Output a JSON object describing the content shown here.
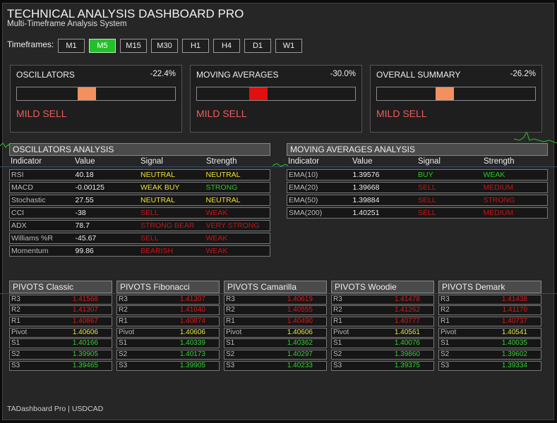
{
  "header": {
    "title": "TECHNICAL ANALYSIS DASHBOARD PRO",
    "subtitle": "Multi-Timeframe Analysis System"
  },
  "timeframes": {
    "label": "Timeframes:",
    "items": [
      "M1",
      "M5",
      "M15",
      "M30",
      "H1",
      "H4",
      "D1",
      "W1"
    ],
    "active": "M5"
  },
  "summary_cards": [
    {
      "title": "OSCILLATORS",
      "percent": "-22.4%",
      "signal": "MILD SELL",
      "gauge_level": 0.44,
      "thumb_color": "#f39060"
    },
    {
      "title": "MOVING AVERAGES",
      "percent": "-30.0%",
      "signal": "MILD SELL",
      "gauge_level": 0.39,
      "thumb_color": "#e01010"
    },
    {
      "title": "OVERALL SUMMARY",
      "percent": "-26.2%",
      "signal": "MILD SELL",
      "gauge_level": 0.43,
      "thumb_color": "#f39060"
    }
  ],
  "oscillators_analysis": {
    "title": "OSCILLATORS ANALYSIS",
    "columns": [
      "Indicator",
      "Value",
      "Signal",
      "Strength"
    ],
    "rows": [
      {
        "indicator": "RSI",
        "value": "40.18",
        "signal": "NEUTRAL",
        "signal_color": "yellow",
        "strength": "NEUTRAL",
        "strength_color": "yellow"
      },
      {
        "indicator": "MACD",
        "value": "-0.00125",
        "signal": "WEAK BUY",
        "signal_color": "yellow",
        "strength": "STRONG",
        "strength_color": "green"
      },
      {
        "indicator": "Stochastic",
        "value": "27.55",
        "signal": "NEUTRAL",
        "signal_color": "yellow",
        "strength": "NEUTRAL",
        "strength_color": "yellow"
      },
      {
        "indicator": "CCI",
        "value": "-38",
        "signal": "SELL",
        "signal_color": "red",
        "strength": "WEAK",
        "strength_color": "red"
      },
      {
        "indicator": "ADX",
        "value": "78.7",
        "signal": "STRONG BEAR",
        "signal_color": "red",
        "strength": "VERY STRONG",
        "strength_color": "red"
      },
      {
        "indicator": "Williams %R",
        "value": "-45.67",
        "signal": "SELL",
        "signal_color": "red",
        "strength": "WEAK",
        "strength_color": "red"
      },
      {
        "indicator": "Momentum",
        "value": "99.86",
        "signal": "BEARISH",
        "signal_color": "red",
        "strength": "WEAK",
        "strength_color": "red"
      }
    ]
  },
  "moving_averages_analysis": {
    "title": "MOVING AVERAGES ANALYSIS",
    "columns": [
      "Indicator",
      "Value",
      "Signal",
      "Strength"
    ],
    "rows": [
      {
        "indicator": "EMA(10)",
        "value": "1.39576",
        "signal": "BUY",
        "signal_color": "green",
        "strength": "WEAK",
        "strength_color": "green"
      },
      {
        "indicator": "EMA(20)",
        "value": "1.39668",
        "signal": "SELL",
        "signal_color": "red",
        "strength": "MEDIUM",
        "strength_color": "red"
      },
      {
        "indicator": "EMA(50)",
        "value": "1.39884",
        "signal": "SELL",
        "signal_color": "red",
        "strength": "STRONG",
        "strength_color": "red"
      },
      {
        "indicator": "SMA(200)",
        "value": "1.40251",
        "signal": "SELL",
        "signal_color": "red",
        "strength": "MEDIUM",
        "strength_color": "red"
      }
    ]
  },
  "pivots": [
    {
      "title": "PIVOTS Classic",
      "rows": [
        [
          "R3",
          "1.41568"
        ],
        [
          "R2",
          "1.41307"
        ],
        [
          "R1",
          "1.40867"
        ],
        [
          "Pivot",
          "1.40606"
        ],
        [
          "S1",
          "1.40166"
        ],
        [
          "S2",
          "1.39905"
        ],
        [
          "S3",
          "1.39465"
        ]
      ]
    },
    {
      "title": "PIVOTS Fibonacci",
      "rows": [
        [
          "R3",
          "1.41307"
        ],
        [
          "R2",
          "1.41040"
        ],
        [
          "R1",
          "1.40874"
        ],
        [
          "Pivot",
          "1.40606"
        ],
        [
          "S1",
          "1.40339"
        ],
        [
          "S2",
          "1.40173"
        ],
        [
          "S3",
          "1.39905"
        ]
      ]
    },
    {
      "title": "PIVOTS Camarilla",
      "rows": [
        [
          "R3",
          "1.40619"
        ],
        [
          "R2",
          "1.40555"
        ],
        [
          "R1",
          "1.40490"
        ],
        [
          "Pivot",
          "1.40606"
        ],
        [
          "S1",
          "1.40362"
        ],
        [
          "S2",
          "1.40297"
        ],
        [
          "S3",
          "1.40233"
        ]
      ]
    },
    {
      "title": "PIVOTS Woodie",
      "rows": [
        [
          "R3",
          "1.41478"
        ],
        [
          "R2",
          "1.41262"
        ],
        [
          "R1",
          "1.40777"
        ],
        [
          "Pivot",
          "1.40561"
        ],
        [
          "S1",
          "1.40076"
        ],
        [
          "S2",
          "1.39860"
        ],
        [
          "S3",
          "1.39375"
        ]
      ]
    },
    {
      "title": "PIVOTS Demark",
      "rows": [
        [
          "R3",
          "1.41438"
        ],
        [
          "R2",
          "1.41170"
        ],
        [
          "R1",
          "1.40737"
        ],
        [
          "Pivot",
          "1.40541"
        ],
        [
          "S1",
          "1.40035"
        ],
        [
          "S2",
          "1.39602"
        ],
        [
          "S3",
          "1.39334"
        ]
      ]
    }
  ],
  "footer": "TADashboard Pro | USDCAD",
  "colors": {
    "yellow": "#f0e030",
    "green": "#27c827",
    "red": "#c81414",
    "active_tf": "#22c02a"
  }
}
